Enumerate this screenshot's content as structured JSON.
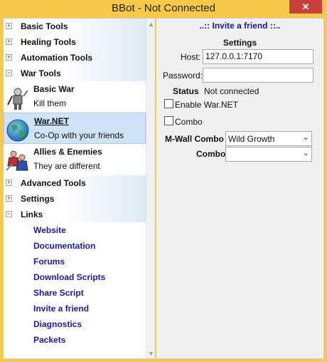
{
  "window": {
    "title": "BBot - Not Connected",
    "close_symbol": "✕"
  },
  "tree": {
    "basic_tools": "Basic Tools",
    "healing_tools": "Healing Tools",
    "automation_tools": "Automation Tools",
    "war_tools": "War Tools",
    "war_items": [
      {
        "title": "Basic War",
        "desc": "Kill them",
        "icon": "warrior-icon"
      },
      {
        "title": "War.NET",
        "desc": "Co-Op with your friends",
        "icon": "globe-icon"
      },
      {
        "title": "Allies & Enemies",
        "desc": "They are different",
        "icon": "allies-icon"
      }
    ],
    "advanced_tools": "Advanced Tools",
    "settings": "Settings",
    "links": "Links",
    "link_items": [
      "Website",
      "Documentation",
      "Forums",
      "Download Scripts",
      "Share Script",
      "Invite a friend",
      "Diagnostics",
      "Packets"
    ],
    "expand_symbol": "+",
    "collapse_symbol": "−"
  },
  "panel": {
    "invite_link": "..:: Invite a friend ::..",
    "settings_header": "Settings",
    "host_label": "Host:",
    "host_value": "127.0.0.1:7170",
    "password_label": "Password:",
    "password_value": "",
    "status_label": "Status",
    "status_value": "Not connected",
    "enable_label": "Enable War.NET",
    "combo_check_label": "Combo",
    "mwall_label": "M-Wall Combo",
    "mwall_value": "Wild Growth",
    "combo_label": "Combo",
    "combo_value": ""
  },
  "colors": {
    "title_bar": "#f7c948",
    "close": "#c7413a",
    "link": "#1a1aa0",
    "selection": "#cfe3f7"
  }
}
